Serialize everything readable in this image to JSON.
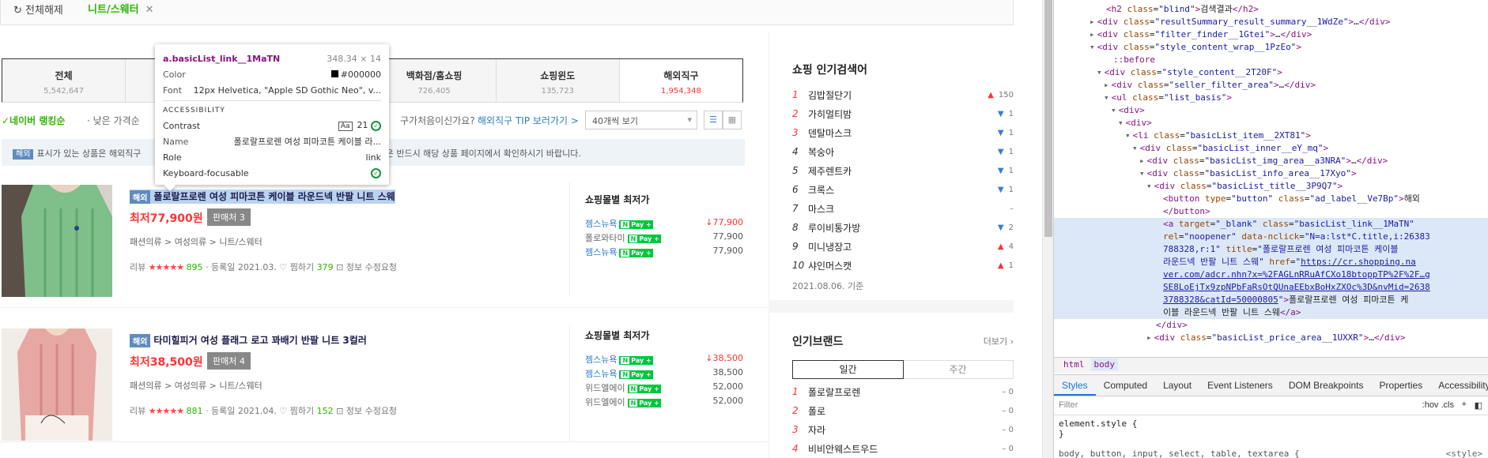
{
  "filterbar": {
    "reset": "전체해제",
    "chip": "니트/스웨터",
    "chip_close": "✕"
  },
  "tabs": [
    {
      "label": "전체",
      "count": "5,542,647",
      "active": false
    },
    {
      "label": "",
      "count": "",
      "active": false
    },
    {
      "label": "",
      "count": "",
      "active": false
    },
    {
      "label": "백화점/홈쇼핑",
      "count": "726,405",
      "active": false
    },
    {
      "label": "쇼핑윈도",
      "count": "135,723",
      "active": false
    },
    {
      "label": "해외직구",
      "count": "1,954,348",
      "active": true
    }
  ],
  "sort": {
    "rank": "✓네이버 랭킹순",
    "low": "· 낮은 가격순",
    "dot": "·",
    "tip_q": "구가처음이신가요?",
    "tip_link": "해외직구 TIP 보러가기 >",
    "view_select": "40개씩 보기",
    "list_icon": "☰",
    "grid_icon": "▦"
  },
  "notice": {
    "tag": "해외",
    "text": "표시가 있는 상품은 해외직구",
    "text2": "대한 제반 사항은 반드시 해당 상품 페이지에서 확인하시기 바랍니다."
  },
  "products": [
    {
      "tag": "해외",
      "title": "폴로랄프로렌 여성 피마코튼 케이블 라운드넥 반팔 니트 스웨",
      "price": "최저77,900원",
      "sellers": "판매처 3",
      "category": "패션의류 > 여성의류 > 니트/스웨터",
      "review_label": "리뷰",
      "stars": "★★★★★",
      "review_count": "895",
      "date": "· 등록일 2021.03.",
      "wish": "♡ 찜하기",
      "wish_count": "379",
      "report": "⊡ 정보 수정요청",
      "mall_header": "쇼핑몰별 최저가",
      "malls": [
        {
          "name": "젬스뉴욕",
          "price": "↓77,900",
          "red": true,
          "gray": false
        },
        {
          "name": "폴로와타미",
          "price": "77,900",
          "red": false,
          "gray": true
        },
        {
          "name": "젬스뉴욕",
          "price": "77,900",
          "red": false,
          "gray": false
        }
      ]
    },
    {
      "tag": "해외",
      "title": "타미힐피거 여성 플래그 로고 꽈배기 반팔 니트 3컬러",
      "price": "최저38,500원",
      "sellers": "판매처 4",
      "category": "패션의류 > 여성의류 > 니트/스웨터",
      "review_label": "리뷰",
      "stars": "★★★★★",
      "review_count": "881",
      "date": "· 등록일 2021.04.",
      "wish": "♡ 찜하기",
      "wish_count": "152",
      "report": "⊡ 정보 수정요청",
      "mall_header": "쇼핑몰별 최저가",
      "malls": [
        {
          "name": "젬스뉴욕",
          "price": "↓38,500",
          "red": true,
          "gray": false
        },
        {
          "name": "젬스뉴욕",
          "price": "38,500",
          "red": false,
          "gray": false
        },
        {
          "name": "위드엘에이",
          "price": "52,000",
          "red": false,
          "gray": true
        },
        {
          "name": "위드엘에이",
          "price": "52,000",
          "red": false,
          "gray": true
        }
      ]
    }
  ],
  "npay": {
    "n": "N",
    "text": "Pay +"
  },
  "popular": {
    "title": "쇼핑 인기검색어",
    "items": [
      {
        "rank": "1",
        "word": "김밥절단기",
        "dir": "▲",
        "change": "150"
      },
      {
        "rank": "2",
        "word": "가히멀티밤",
        "dir": "▼",
        "change": "1"
      },
      {
        "rank": "3",
        "word": "덴탈마스크",
        "dir": "▼",
        "change": "1"
      },
      {
        "rank": "4",
        "word": "복숭아",
        "dir": "▼",
        "change": "1"
      },
      {
        "rank": "5",
        "word": "제주렌트카",
        "dir": "▼",
        "change": "1"
      },
      {
        "rank": "6",
        "word": "크록스",
        "dir": "▼",
        "change": "1"
      },
      {
        "rank": "7",
        "word": "마스크",
        "dir": "",
        "change": "–"
      },
      {
        "rank": "8",
        "word": "루이비통가방",
        "dir": "▼",
        "change": "2"
      },
      {
        "rank": "9",
        "word": "미니냉장고",
        "dir": "▲",
        "change": "4"
      },
      {
        "rank": "10",
        "word": "샤인머스캣",
        "dir": "▲",
        "change": "1"
      }
    ],
    "date": "2021.08.06. 기준"
  },
  "brands": {
    "title": "인기브랜드",
    "more": "더보기 ›",
    "tabs": [
      "일간",
      "주간"
    ],
    "items": [
      {
        "rank": "1",
        "word": "폴로랄프로렌",
        "change": "–  0"
      },
      {
        "rank": "2",
        "word": "폴로",
        "change": "–  0"
      },
      {
        "rank": "3",
        "word": "자라",
        "change": "–  0"
      },
      {
        "rank": "4",
        "word": "비비안웨스트우드",
        "change": "–  0"
      }
    ]
  },
  "tooltip": {
    "selector": "a.basicList_link__1MaTN",
    "dims": "348.34 × 14",
    "color_label": "Color",
    "color_value": "#000000",
    "font_label": "Font",
    "font_value": "12px Helvetica, \"Apple SD Gothic Neo\", v...",
    "acc_header": "ACCESSIBILITY",
    "contrast_label": "Contrast",
    "contrast_aa": "Aa",
    "contrast_value": "21",
    "name_label": "Name",
    "name_value": "폴로랄프로렌 여성 피마코튼 케이블 라...",
    "role_label": "Role",
    "role_value": "link",
    "kb_label": "Keyboard-focusable",
    "check": "✓"
  },
  "devtools": {
    "crumbs": [
      "html",
      "body"
    ],
    "tabs": [
      "Styles",
      "Computed",
      "Layout",
      "Event Listeners",
      "DOM Breakpoints",
      "Properties",
      "Accessibility"
    ],
    "filter_placeholder": "Filter",
    "hov": ":hov .cls",
    "plus": "+",
    "icon": "◧",
    "style1a": "element.style {",
    "style1b": "}",
    "style2": "body, button, input, select, table, textarea {",
    "style2_src": "<style>",
    "lines": [
      {
        "indent": 6,
        "arrow": "",
        "html": "<span class='tg'>&lt;h2</span> <span class='at'>class</span>=<span class='av'>\"blind\"</span><span class='tg'>&gt;</span>검색결과<span class='tg'>&lt;/h2&gt;</span>"
      },
      {
        "indent": 5,
        "arrow": "▸",
        "html": "<span class='tg'>&lt;div</span> <span class='at'>class</span>=<span class='av'>\"resultSummary_result_summary__1WdZe\"</span><span class='tg'>&gt;</span>…<span class='tg'>&lt;/div&gt;</span>"
      },
      {
        "indent": 5,
        "arrow": "▸",
        "html": "<span class='tg'>&lt;div</span> <span class='at'>class</span>=<span class='av'>\"filter_finder__1Gtei\"</span><span class='tg'>&gt;</span>…<span class='tg'>&lt;/div&gt;</span>"
      },
      {
        "indent": 5,
        "arrow": "▾",
        "html": "<span class='tg'>&lt;div</span> <span class='at'>class</span>=<span class='av'>\"style_content_wrap__1PzEo\"</span><span class='tg'>&gt;</span>"
      },
      {
        "indent": 7,
        "arrow": "",
        "html": "<span class='tg'>::before</span>"
      },
      {
        "indent": 6,
        "arrow": "▾",
        "html": "<span class='tg'>&lt;div</span> <span class='at'>class</span>=<span class='av'>\"style_content__2T20F\"</span><span class='tg'>&gt;</span>"
      },
      {
        "indent": 7,
        "arrow": "▸",
        "html": "<span class='tg'>&lt;div</span> <span class='at'>class</span>=<span class='av'>\"seller_filter_area\"</span><span class='tg'>&gt;</span>…<span class='tg'>&lt;/div&gt;</span>"
      },
      {
        "indent": 7,
        "arrow": "▾",
        "html": "<span class='tg'>&lt;ul</span> <span class='at'>class</span>=<span class='av'>\"list_basis\"</span><span class='tg'>&gt;</span>"
      },
      {
        "indent": 8,
        "arrow": "▾",
        "html": "<span class='tg'>&lt;div&gt;</span>"
      },
      {
        "indent": 9,
        "arrow": "▾",
        "html": "<span class='tg'>&lt;div&gt;</span>"
      },
      {
        "indent": 10,
        "arrow": "▾",
        "html": "<span class='tg'>&lt;li</span> <span class='at'>class</span>=<span class='av'>\"basicList_item__2XT81\"</span><span class='tg'>&gt;</span>"
      },
      {
        "indent": 11,
        "arrow": "▾",
        "html": "<span class='tg'>&lt;div</span> <span class='at'>class</span>=<span class='av'>\"basicList_inner__eY_mq\"</span><span class='tg'>&gt;</span>"
      },
      {
        "indent": 12,
        "arrow": "▸",
        "html": "<span class='tg'>&lt;div</span> <span class='at'>class</span>=<span class='av'>\"basicList_img_area__a3NRA\"</span><span class='tg'>&gt;</span>…<span class='tg'>&lt;/div&gt;</span>"
      },
      {
        "indent": 12,
        "arrow": "▾",
        "html": "<span class='tg'>&lt;div</span> <span class='at'>class</span>=<span class='av'>\"basicList_info_area__17Xyo\"</span><span class='tg'>&gt;</span>"
      },
      {
        "indent": 13,
        "arrow": "▾",
        "html": "<span class='tg'>&lt;div</span> <span class='at'>class</span>=<span class='av'>\"basicList_title__3P9Q7\"</span><span class='tg'>&gt;</span>"
      },
      {
        "indent": 14,
        "arrow": "",
        "html": "<span class='tg'>&lt;button</span> <span class='at'>type</span>=<span class='av'>\"button\"</span> <span class='at'>class</span>=<span class='av'>\"ad_label__Ve7Bp\"</span><span class='tg'>&gt;</span>해외"
      },
      {
        "indent": 14,
        "arrow": "",
        "html": "<span class='tg'>&lt;/button&gt;</span>"
      },
      {
        "indent": 14,
        "arrow": "",
        "sel": true,
        "html": "<span class='tg'>&lt;a</span> <span class='at'>target</span>=<span class='av'>\"_blank\"</span> <span class='at'>class</span>=<span class='av'>\"basicList_link__1MaTN\"</span>"
      },
      {
        "indent": 14,
        "arrow": "",
        "sel": true,
        "html": "<span class='at'>rel</span>=<span class='av'>\"noopener\"</span> <span class='at'>data-nclick</span>=<span class='av'>\"N=a:lst*C.title,i:26383</span>"
      },
      {
        "indent": 14,
        "arrow": "",
        "sel": true,
        "html": "<span class='av'>788328,r:1\"</span> <span class='at'>title</span>=<span class='av'>\"폴로랄프로렌 여성 피마코튼 케이블</span>"
      },
      {
        "indent": 14,
        "arrow": "",
        "sel": true,
        "html": "<span class='av'>라운드넥 반팔 니트 스웨\"</span> <span class='at'>href</span>=<span class='av'>\"</span><span class='lk'>https://cr.shopping.na</span>"
      },
      {
        "indent": 14,
        "arrow": "",
        "sel": true,
        "html": "<span class='lk'>ver.com/adcr.nhn?x=%2FAGLnRRuAfCXo18btoppTP%2F%2F…g</span>"
      },
      {
        "indent": 14,
        "arrow": "",
        "sel": true,
        "html": "<span class='lk'>SE8LoEjTx9zpNPbFaRsOtQUnaEEbxBoHxZXOc%3D&amp;nvMid=2638</span>"
      },
      {
        "indent": 14,
        "arrow": "",
        "sel": true,
        "html": "<span class='lk'>3788328&amp;catId=50000805</span><span class='av'>\"</span><span class='tg'>&gt;</span>폴로랄프로렌 여성 피마코튼 케"
      },
      {
        "indent": 14,
        "arrow": "",
        "sel": true,
        "html": "이블 라운드넥 반팔 니트 스웨<span class='tg'>&lt;/a&gt;</span>"
      },
      {
        "indent": 13,
        "arrow": "",
        "html": "<span class='tg'>&lt;/div&gt;</span>"
      },
      {
        "indent": 13,
        "arrow": "▸",
        "html": "<span class='tg'>&lt;div</span> <span class='at'>class</span>=<span class='av'>\"basicList_price_area__1UXXR\"</span><span class='tg'>&gt;</span>…<span class='tg'>&lt;/div&gt;</span>"
      }
    ]
  }
}
